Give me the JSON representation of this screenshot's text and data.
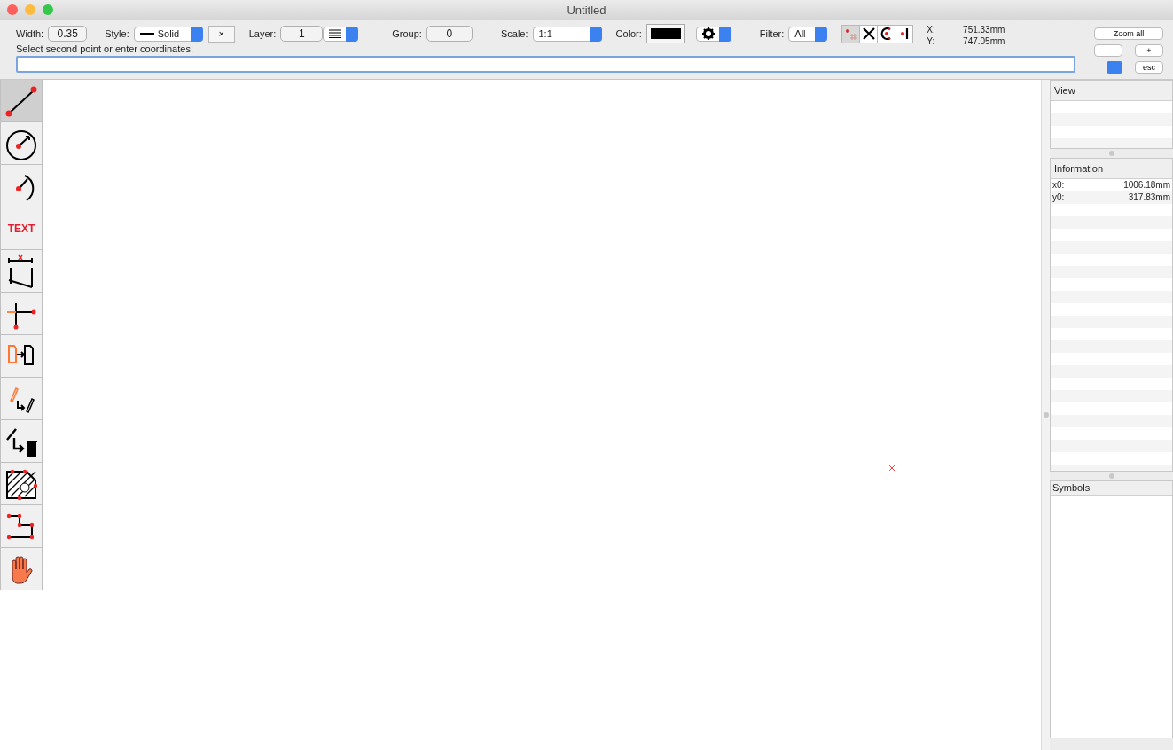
{
  "window": {
    "title": "Untitled"
  },
  "toolbar": {
    "width": {
      "label": "Width:",
      "value": "0.35"
    },
    "style": {
      "label": "Style:",
      "value": "Solid"
    },
    "clear_button": "×",
    "layer": {
      "label": "Layer:",
      "value": "1"
    },
    "group": {
      "label": "Group:",
      "value": "0"
    },
    "scale": {
      "label": "Scale:",
      "value": "1:1"
    },
    "color": {
      "label": "Color:"
    },
    "filter": {
      "label": "Filter:",
      "value": "All"
    },
    "snap_buttons": [
      {
        "kind": "grid",
        "selected": true
      },
      {
        "kind": "intersection",
        "selected": false
      },
      {
        "kind": "center",
        "selected": false
      },
      {
        "kind": "endpoint",
        "selected": false
      }
    ],
    "coords": [
      {
        "label": "X:",
        "value": "751.33mm"
      },
      {
        "label": "Y:",
        "value": "747.05mm"
      }
    ],
    "zoom_buttons": [
      "Zoom all",
      "-",
      "+"
    ],
    "esc_button": "esc"
  },
  "prompt": "Select second point or enter coordinates:",
  "tools": [
    {
      "kind": "line",
      "selected": true
    },
    {
      "kind": "circle",
      "selected": false
    },
    {
      "kind": "arc",
      "selected": false
    },
    {
      "kind": "text",
      "label": "TEXT",
      "selected": false
    },
    {
      "kind": "dimension",
      "selected": false
    },
    {
      "kind": "axes",
      "selected": false
    },
    {
      "kind": "move",
      "selected": false
    },
    {
      "kind": "edit",
      "selected": false
    },
    {
      "kind": "delete",
      "selected": false
    },
    {
      "kind": "hatch",
      "selected": false
    },
    {
      "kind": "polyline",
      "selected": false
    },
    {
      "kind": "pan",
      "selected": false
    }
  ],
  "panels": [
    {
      "title": "View"
    },
    {
      "title": "Information",
      "rows": [
        {
          "key": "x0:",
          "value": "1006.18mm"
        },
        {
          "key": "y0:",
          "value": "317.83mm"
        }
      ]
    },
    {
      "title": "Symbols"
    }
  ]
}
